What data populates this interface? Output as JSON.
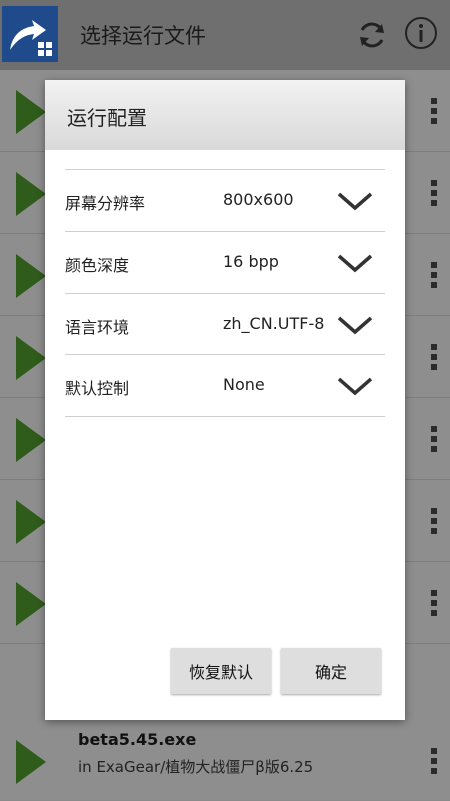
{
  "appbar": {
    "title": "选择运行文件",
    "refresh_icon": "refresh-icon",
    "info_icon": "info-icon"
  },
  "list": {
    "rows": [
      {},
      {},
      {},
      {},
      {},
      {},
      {},
      {
        "title": "beta5.45.exe",
        "subtitle": "in ExaGear/植物大战僵尸β版6.25"
      }
    ]
  },
  "dialog": {
    "title": "运行配置",
    "settings": [
      {
        "label": "屏幕分辨率",
        "value": "800x600"
      },
      {
        "label": "颜色深度",
        "value": "16 bpp"
      },
      {
        "label": "语言环境",
        "value": "zh_CN.UTF-8"
      },
      {
        "label": "默认控制",
        "value": "None"
      }
    ],
    "buttons": {
      "reset": "恢复默认",
      "ok": "确定"
    }
  },
  "colors": {
    "play_green": "#2f5b1b",
    "dialog_bg": "#ffffff",
    "overlay": "#8a8a8a"
  }
}
